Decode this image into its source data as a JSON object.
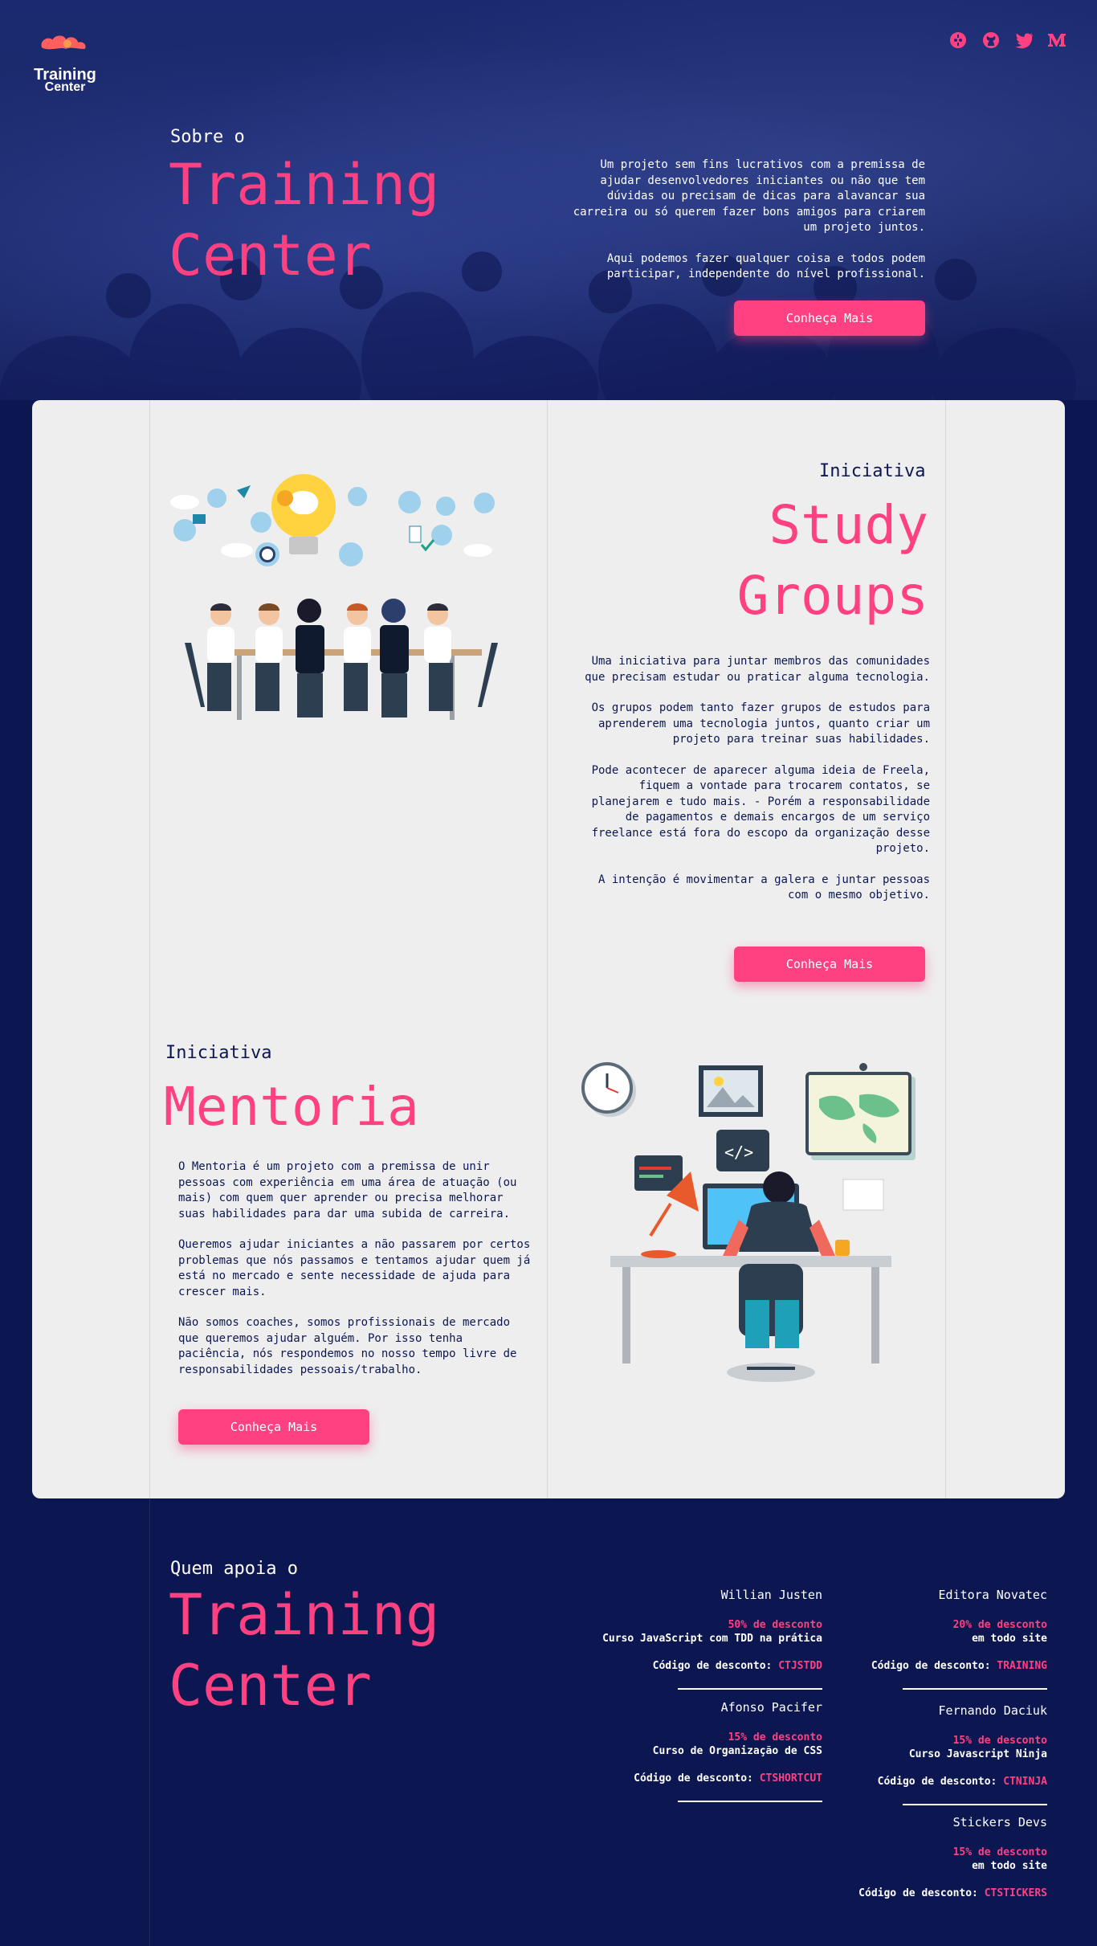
{
  "header": {
    "logo_line1": "Training",
    "logo_line2": "Center",
    "socials": [
      "discord-icon",
      "github-icon",
      "twitter-icon",
      "medium-icon"
    ]
  },
  "hero": {
    "subtitle": "Sobre o",
    "title_line1": "Training",
    "title_line2": "Center",
    "paragraph1": "Um projeto sem fins lucrativos com a premissa de ajudar desenvolvedores iniciantes ou não que tem dúvidas ou precisam de dicas para alavancar sua carreira ou só querem fazer bons amigos para criarem um projeto juntos.",
    "paragraph2": "Aqui podemos fazer qualquer coisa e todos podem participar, independente do nível profissional.",
    "button": "Conheça Mais"
  },
  "study_groups": {
    "kicker": "Iniciativa",
    "title_line1": "Study",
    "title_line2": "Groups",
    "paragraphs": [
      "Uma iniciativa para juntar membros das comunidades que precisam estudar ou praticar alguma tecnologia.",
      "Os grupos podem tanto fazer grupos de estudos para aprenderem uma tecnologia juntos, quanto criar um projeto para treinar suas habilidades.",
      "Pode acontecer de aparecer alguma ideia de Freela, fiquem a vontade para trocarem contatos, se planejarem e tudo mais. - Porém a responsabilidade de pagamentos e demais encargos de um serviço freelance está fora do escopo da organização desse projeto.",
      "A intenção é movimentar a galera e juntar pessoas com o mesmo objetivo."
    ],
    "button": "Conheça Mais"
  },
  "mentoria": {
    "kicker": "Iniciativa",
    "title": "Mentoria",
    "paragraphs": [
      "O Mentoria é um projeto com a premissa de unir pessoas com experiência em uma área de atuação (ou mais) com quem quer aprender ou precisa melhorar suas habilidades para dar uma subida de carreira.",
      "Queremos ajudar iniciantes a não passarem por certos problemas que nós passamos e tentamos ajudar quem já está no mercado e sente necessidade de ajuda para crescer mais.",
      "Não somos coaches, somos profissionais de mercado que queremos ajudar alguém. Por isso tenha paciência, nós respondemos no nosso tempo livre de responsabilidades pessoais/trabalho."
    ],
    "button": "Conheça Mais"
  },
  "supporters": {
    "subtitle": "Quem apoia o",
    "title_line1": "Training",
    "title_line2": "Center",
    "code_label": "Código de desconto:",
    "items": [
      {
        "name": "Willian Justen",
        "discount": "50% de desconto",
        "course": "Curso JavaScript com TDD na prática",
        "code": "CTJSTDD"
      },
      {
        "name": "Editora Novatec",
        "discount": "20% de desconto",
        "course": "em todo site",
        "code": "TRAINING"
      },
      {
        "name": "Afonso Pacifer",
        "discount": "15% de desconto",
        "course": "Curso de Organização de CSS",
        "code": "CTSHORTCUT"
      },
      {
        "name": "Fernando Daciuk",
        "discount": "15% de desconto",
        "course": "Curso Javascript Ninja",
        "code": "CTNINJA"
      },
      {
        "name": "Stickers Devs",
        "discount": "15% de desconto",
        "course": "em todo site",
        "code": "CTSTICKERS"
      }
    ]
  }
}
